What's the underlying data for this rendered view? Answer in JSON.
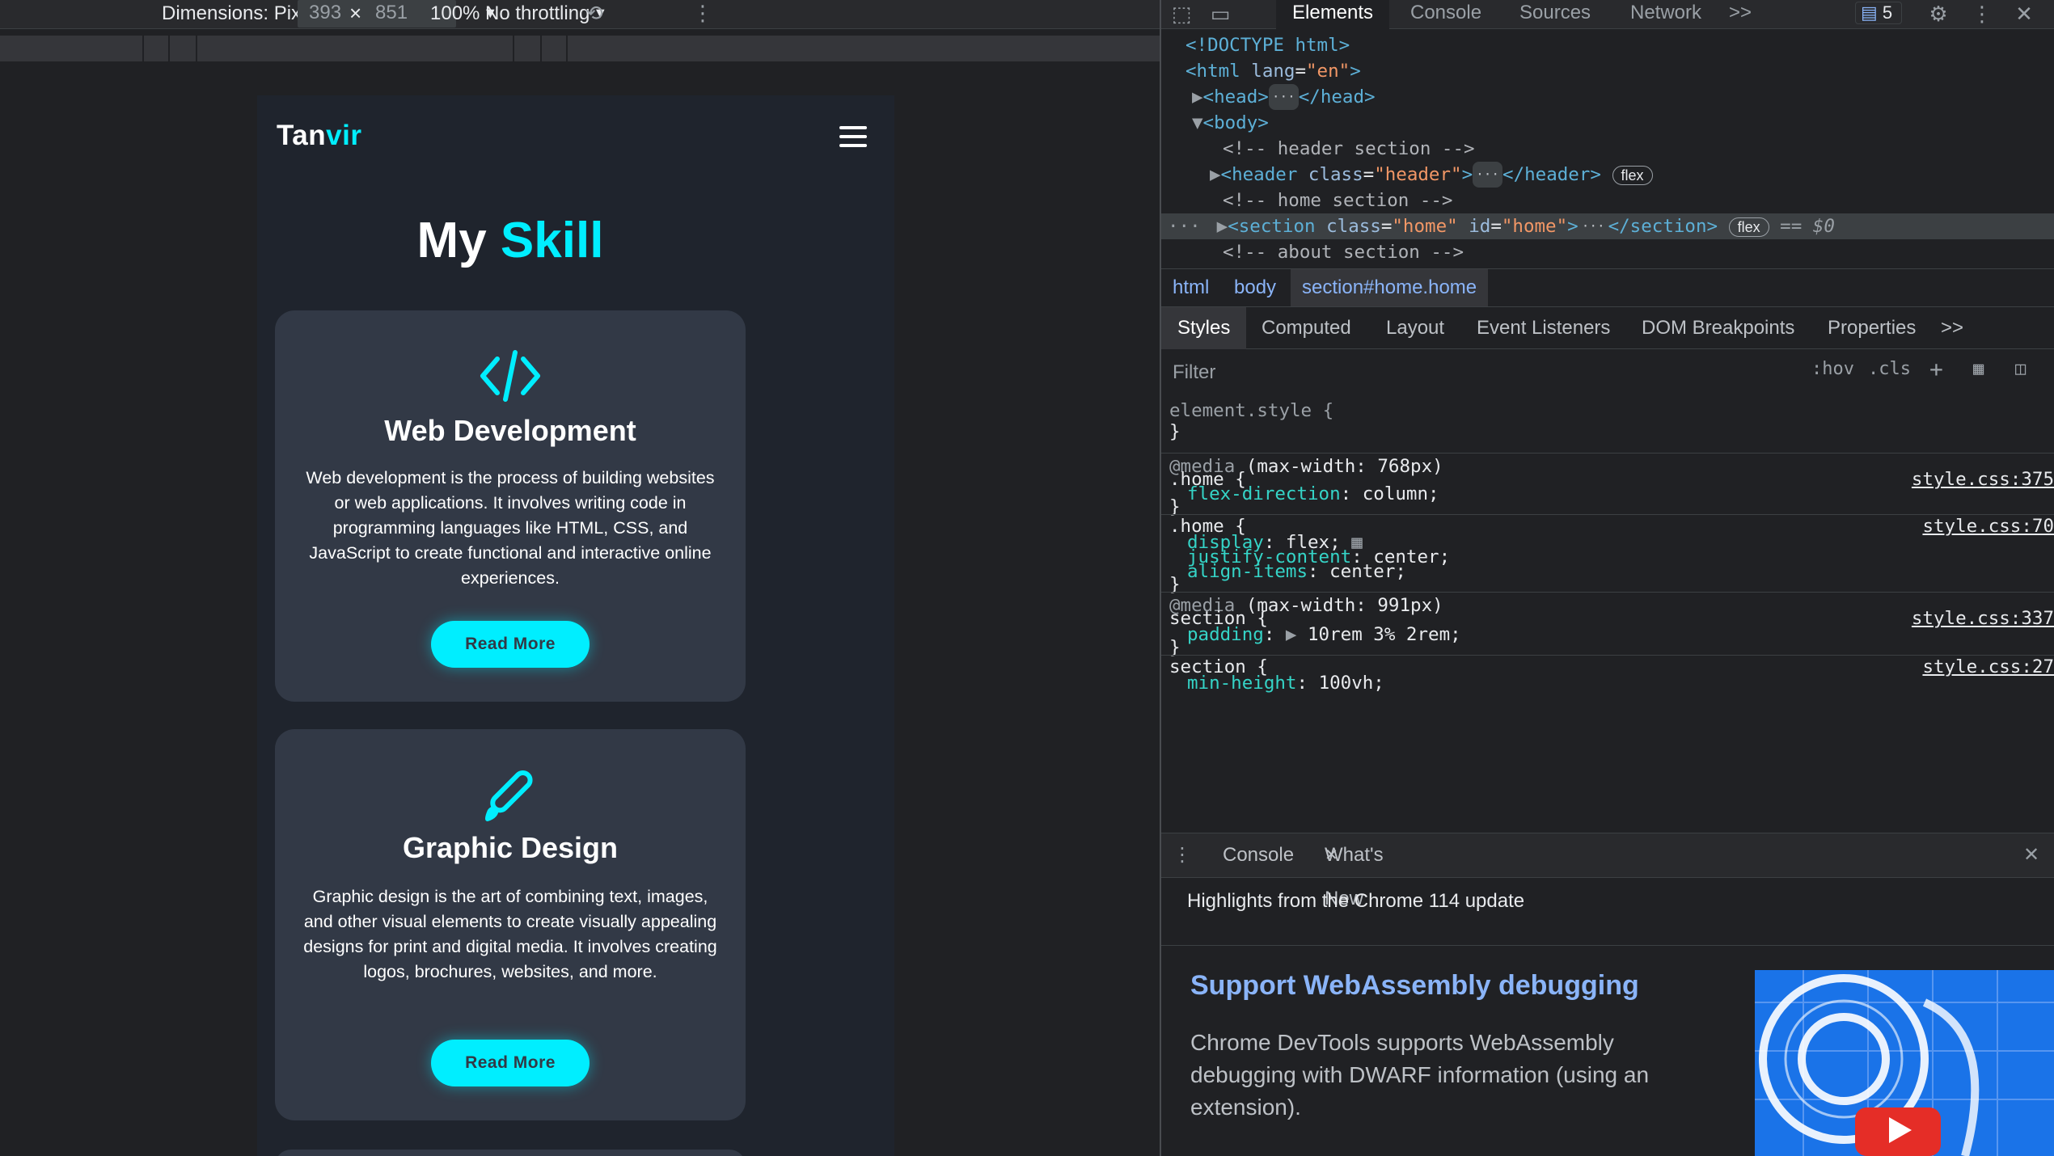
{
  "device_toolbar": {
    "dimensions_label": "Dimensions: Pixel 5",
    "width": "393",
    "height": "851",
    "times": "×",
    "zoom": "100%",
    "throttling": "No throttling"
  },
  "site": {
    "logo_main": "Tan",
    "logo_accent": "vir",
    "heading_main": "My",
    "heading_accent": "Skill",
    "cards": [
      {
        "title": "Web Development",
        "description": "Web development is the process of building websites or web applications. It involves writing code in programming languages like HTML, CSS, and JavaScript to create functional and interactive online experiences.",
        "button": "Read More"
      },
      {
        "title": "Graphic Design",
        "description": "Graphic design is the art of combining text, images, and other visual elements to create visually appealing designs for print and digital media. It involves creating logos, brochures, websites, and more.",
        "button": "Read More"
      }
    ],
    "accent_color": "#00eeff",
    "background_color": "#1f242d",
    "card_color": "#323946"
  },
  "devtools": {
    "tabs": [
      "Elements",
      "Console",
      "Sources",
      "Network"
    ],
    "more_tabs": ">>",
    "issues_count": "5",
    "dom": {
      "doctype": "<!DOCTYPE html>",
      "html_open": "<html",
      "html_attr": "lang",
      "html_val": "\"en\"",
      "head_open": "<head>",
      "head_close": "</head>",
      "body_open": "<body>",
      "comment_header": "<!-- header section -->",
      "header_open": "<header",
      "header_attr": "class",
      "header_val": "\"header\"",
      "header_close": "</header>",
      "comment_home": "<!-- home section -->",
      "section_open": "<section",
      "section_attr_class": "class",
      "section_val_class": "\"home\"",
      "section_attr_id": "id",
      "section_val_id": "\"home\"",
      "section_close": "</section>",
      "comment_about": "<!-- about section  -->",
      "flex_badge": "flex",
      "selected_marker": "== $0"
    },
    "breadcrumbs": [
      "html",
      "body",
      "section#home.home"
    ],
    "sub_tabs": [
      "Styles",
      "Computed",
      "Layout",
      "Event Listeners",
      "DOM Breakpoints",
      "Properties"
    ],
    "filter_placeholder": "Filter",
    "filter_tools": [
      ":hov",
      ".cls"
    ],
    "styles": {
      "element_style": "element.style {",
      "close_brace": "}",
      "media_768": "(max-width: 768px)",
      "media_keyword": "@media",
      "home_selector": ".home {",
      "flex_direction_prop": "flex-direction",
      "flex_direction_val": "column;",
      "src_375": "style.css:375",
      "src_70": "style.css:70",
      "display_prop": "display",
      "display_val": "flex;",
      "justify_prop": "justify-content",
      "justify_val": "center;",
      "align_prop": "align-items",
      "align_val": "center;",
      "media_991": "(max-width: 991px)",
      "section_selector": "section {",
      "padding_prop": "padding",
      "padding_val": "10rem 3% 2rem;",
      "src_337": "style.css:337",
      "src_27": "style.css:27",
      "min_height_prop": "min-height",
      "min_height_val": "100vh;"
    },
    "drawer": {
      "tabs": [
        "Console",
        "What's New"
      ],
      "highlights": "Highlights from the Chrome 114 update",
      "title": "Support WebAssembly debugging",
      "body": "Chrome DevTools supports WebAssembly debugging with DWARF information (using an extension)."
    }
  }
}
